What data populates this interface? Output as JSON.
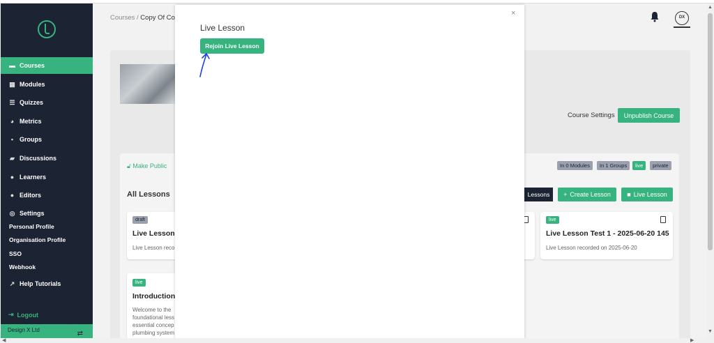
{
  "breadcrumb": {
    "root": "Courses",
    "sep": " / ",
    "current": "Copy Of Co"
  },
  "sidebar": {
    "items": [
      {
        "label": "Courses",
        "icon": "briefcase-icon",
        "glyph": "▬",
        "active": true
      },
      {
        "label": "Modules",
        "icon": "grid-icon",
        "glyph": "▦"
      },
      {
        "label": "Quizzes",
        "icon": "list-icon",
        "glyph": "☰"
      },
      {
        "label": "Metrics",
        "icon": "pie-chart-icon",
        "glyph": "◕"
      },
      {
        "label": "Groups",
        "icon": "groups-icon",
        "glyph": "▪"
      },
      {
        "label": "Discussions",
        "icon": "chat-icon",
        "glyph": "▰"
      },
      {
        "label": "Learners",
        "icon": "users-icon",
        "glyph": "●"
      },
      {
        "label": "Editors",
        "icon": "user-edit-icon",
        "glyph": "●"
      },
      {
        "label": "Settings",
        "icon": "gear-icon",
        "glyph": "◎"
      }
    ],
    "sub_items": [
      "Personal Profile",
      "Organisation Profile",
      "SSO",
      "Webhook"
    ],
    "help": "Help Tutorials",
    "logout": "Logout",
    "org_name": "Design X Ltd"
  },
  "header": {
    "avatar_initials": "DX"
  },
  "course": {
    "settings_label": "Course Settings",
    "unpublish_label": "Unpublish Course",
    "make_public": "Make Public",
    "badges": [
      "In 0 Modules",
      "In 1 Groups",
      "live",
      "private"
    ]
  },
  "lessons": {
    "heading": "All Lessons",
    "dark_button": "Lessons",
    "create_button": "Create Lesson",
    "live_button": "Live Lesson",
    "cards": [
      {
        "badge": "draft",
        "title": "Live Lesson -",
        "subtitle": "Live Lesson reco"
      },
      {
        "badge": "live",
        "title": "Live Lesson Test 1 - 2025-06-20 145",
        "subtitle": "Live Lesson recorded on 2025-06-20"
      },
      {
        "badge": "live",
        "title": "Introduction t",
        "desc": [
          "Welcome to the",
          "foundational less",
          "essential concep",
          "plumbing system"
        ]
      }
    ]
  },
  "modal": {
    "title": "Live Lesson",
    "rejoin_label": "Rejoin Live Lesson",
    "close": "×"
  },
  "colors": {
    "accent": "#36b37e",
    "sidebar_bg": "#1c2333"
  }
}
